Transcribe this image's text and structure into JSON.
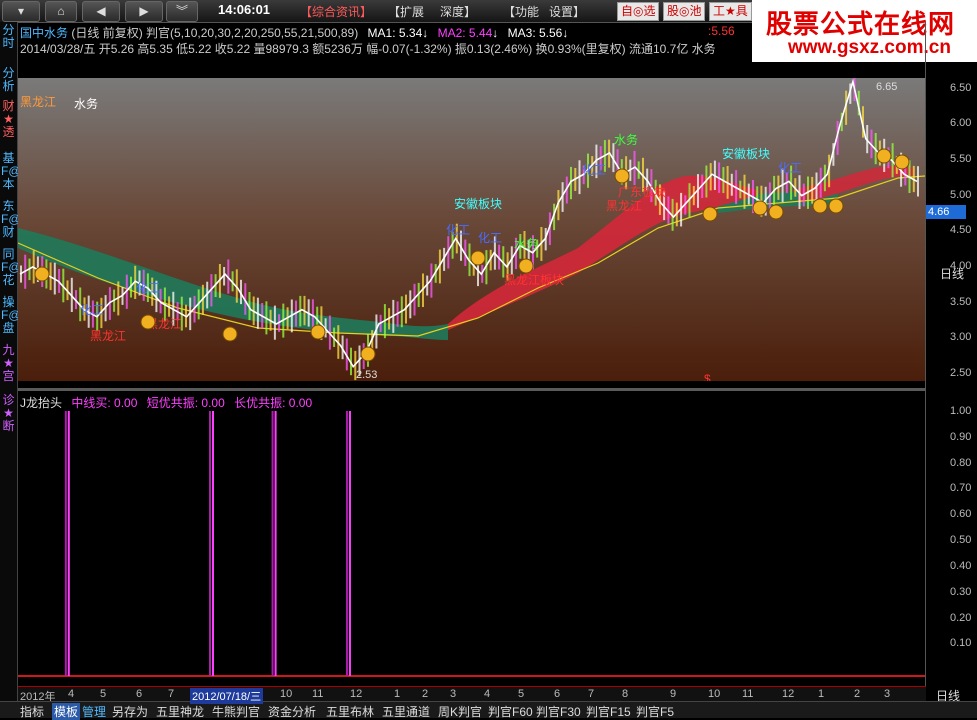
{
  "toolbar": {
    "clock": "14:06:01",
    "menu": [
      "【综合资讯】",
      "【扩展",
      "深度】",
      "【功能",
      "设置】"
    ],
    "chips": [
      "自◎选",
      "股◎池",
      "工★具"
    ]
  },
  "logo": {
    "line1": "股票公式在线网",
    "line2": "www.gsxz.com.cn"
  },
  "left_tabs": [
    "分时",
    "分析",
    "财★透",
    "基F@本",
    "东F@财",
    "同F@花",
    "操F@盘",
    "九★宫",
    "诊★断"
  ],
  "header": {
    "title": "国中水务",
    "mode": "(日线 前复权)",
    "indicator": "判官(5,10,20,30,2,20,250,55,21,500,89)",
    "ma1": "MA1: 5.34",
    "ma2": "MA2: 5.44",
    "ma3": "MA3: 5.56",
    "right_val": "5.56",
    "line2": "2014/03/28/五 开5.26 高5.35 低5.22 收5.22 量98979.3 额5236万 幅-0.07(-1.32%) 振0.13(2.46%) 换0.93%(里复权) 流通10.7亿 水务"
  },
  "colors": {
    "accent": "#1e6bd8",
    "up": "#ff3232",
    "down": "#32c8ff",
    "magenta": "#ff40ff"
  },
  "chart_labels": {
    "tl1": "黑龙江",
    "tl2": "水务",
    "hi_price": "6.65",
    "lo_price": "2.53",
    "last": "4.66",
    "annotations": [
      {
        "text": "黑龙江",
        "color": "#ff3232"
      },
      {
        "text": "化工",
        "color": "#4a6cff"
      },
      {
        "text": "化工",
        "color": "#4a6cff"
      },
      {
        "text": "黑龙江",
        "color": "#ff3232"
      },
      {
        "text": "安徽板块",
        "color": "#40ffff"
      },
      {
        "text": "化工",
        "color": "#4a6cff"
      },
      {
        "text": "化工",
        "color": "#4a6cff"
      },
      {
        "text": "水务",
        "color": "#40ff40"
      },
      {
        "text": "黑龙江板块",
        "color": "#ff3232"
      },
      {
        "text": "水务",
        "color": "#40ff40"
      },
      {
        "text": "化工",
        "color": "#4a6cff"
      },
      {
        "text": "广东板块",
        "color": "#ff3232"
      },
      {
        "text": "黑龙江",
        "color": "#ff3232"
      },
      {
        "text": "安徽板块",
        "color": "#40ffff"
      },
      {
        "text": "化工",
        "color": "#4a6cff"
      }
    ],
    "dollar": "$"
  },
  "yaxis_main": [
    "6.50",
    "6.00",
    "5.50",
    "5.00",
    "4.50",
    "4.00",
    "3.50",
    "3.00",
    "2.50"
  ],
  "yaxis_ind": [
    "1.00",
    "0.90",
    "0.80",
    "0.70",
    "0.60",
    "0.50",
    "0.40",
    "0.30",
    "0.20",
    "0.10"
  ],
  "right_labels": {
    "daily_main": "日线",
    "daily_bottom": "日线"
  },
  "indicator_header": {
    "name": "J龙抬头",
    "l1": "中线买: 0.00",
    "l2": "短优共振: 0.00",
    "l3": "长优共振: 0.00"
  },
  "dates": [
    "2012年",
    "4",
    "5",
    "6",
    "7",
    "8",
    "2012/07/18/三",
    "10",
    "11",
    "12",
    "1",
    "2",
    "3",
    "4",
    "5",
    "6",
    "7",
    "8",
    "9",
    "10",
    "11",
    "12",
    "1",
    "2",
    "3"
  ],
  "bottom_tabs": [
    "指标",
    "模板",
    "管理",
    "另存为",
    "五里神龙",
    "牛熊判官",
    "资金分析",
    "五里布林",
    "五里通道",
    "周K判官",
    "判官F60",
    "判官F30",
    "判官F15",
    "判官F5"
  ],
  "chart_data": {
    "type": "line",
    "title": "",
    "price_series_approx": [
      3.9,
      4.0,
      3.9,
      3.8,
      3.6,
      3.4,
      3.3,
      3.5,
      3.6,
      3.8,
      3.7,
      3.5,
      3.4,
      3.3,
      3.5,
      3.7,
      3.9,
      3.7,
      3.4,
      3.3,
      3.2,
      3.3,
      3.4,
      3.3,
      3.1,
      2.9,
      2.6,
      2.8,
      3.2,
      3.3,
      3.4,
      3.6,
      3.8,
      4.1,
      4.4,
      4.1,
      3.9,
      4.2,
      4.0,
      4.3,
      4.2,
      4.4,
      4.9,
      5.2,
      5.3,
      5.5,
      5.6,
      5.3,
      5.4,
      5.2,
      4.9,
      4.7,
      4.9,
      5.1,
      5.3,
      5.2,
      5.1,
      5.0,
      4.9,
      5.1,
      5.2,
      5.0,
      5.1,
      5.3,
      6.0,
      6.6,
      5.8,
      5.6,
      5.5,
      5.3,
      5.2
    ],
    "indicator_spikes_x_fraction": [
      0.056,
      0.215,
      0.284,
      0.366
    ],
    "indicator_range": [
      0,
      1
    ],
    "ylim": [
      2.4,
      6.65
    ]
  }
}
